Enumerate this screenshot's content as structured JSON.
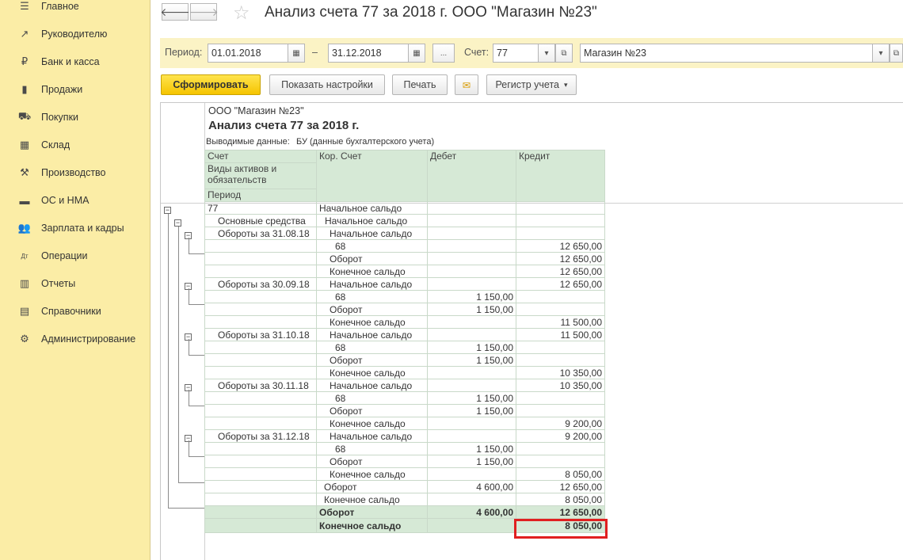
{
  "sidebar": {
    "items": [
      {
        "label": "Главное",
        "icon": "☰"
      },
      {
        "label": "Руководителю",
        "icon": "↗"
      },
      {
        "label": "Банк и касса",
        "icon": "₽"
      },
      {
        "label": "Продажи",
        "icon": "▮"
      },
      {
        "label": "Покупки",
        "icon": "⛟"
      },
      {
        "label": "Склад",
        "icon": "▦"
      },
      {
        "label": "Производство",
        "icon": "⚒"
      },
      {
        "label": "ОС и НМА",
        "icon": "▬"
      },
      {
        "label": "Зарплата и кадры",
        "icon": "👥"
      },
      {
        "label": "Операции",
        "icon": "Дт"
      },
      {
        "label": "Отчеты",
        "icon": "▥"
      },
      {
        "label": "Справочники",
        "icon": "▤"
      },
      {
        "label": "Администрирование",
        "icon": "⚙"
      }
    ]
  },
  "header": {
    "title": "Анализ счета 77 за 2018 г. ООО \"Магазин №23\""
  },
  "filters": {
    "period_label": "Период:",
    "date_from": "01.01.2018",
    "dash": "–",
    "date_to": "31.12.2018",
    "more": "...",
    "account_label": "Счет:",
    "account": "77",
    "org": "Магазин №23"
  },
  "toolbar": {
    "generate": "Сформировать",
    "settings": "Показать настройки",
    "print": "Печать",
    "register": "Регистр учета"
  },
  "report": {
    "org": "ООО \"Магазин №23\"",
    "title": "Анализ счета 77 за 2018 г.",
    "output_label": "Выводимые данные:",
    "output_value": "БУ (данные бухгалтерского учета)",
    "headers": {
      "account": "Счет",
      "assets": "Виды активов и обязательств",
      "period": "Период",
      "corr": "Кор. Счет",
      "debit": "Дебет",
      "credit": "Кредит"
    },
    "rows": [
      {
        "c1": "77",
        "c2": "Начальное сальдо",
        "d": "",
        "k": ""
      },
      {
        "c1": "Основные средства",
        "c2": "Начальное сальдо",
        "d": "",
        "k": ""
      },
      {
        "c1": "Обороты за 31.08.18",
        "c2": "Начальное сальдо",
        "d": "",
        "k": ""
      },
      {
        "c1": "",
        "c2": "68",
        "d": "",
        "k": "12 650,00"
      },
      {
        "c1": "",
        "c2": "Оборот",
        "d": "",
        "k": "12 650,00"
      },
      {
        "c1": "",
        "c2": "Конечное сальдо",
        "d": "",
        "k": "12 650,00"
      },
      {
        "c1": "Обороты за 30.09.18",
        "c2": "Начальное сальдо",
        "d": "",
        "k": "12 650,00"
      },
      {
        "c1": "",
        "c2": "68",
        "d": "1 150,00",
        "k": ""
      },
      {
        "c1": "",
        "c2": "Оборот",
        "d": "1 150,00",
        "k": ""
      },
      {
        "c1": "",
        "c2": "Конечное сальдо",
        "d": "",
        "k": "11 500,00"
      },
      {
        "c1": "Обороты за 31.10.18",
        "c2": "Начальное сальдо",
        "d": "",
        "k": "11 500,00"
      },
      {
        "c1": "",
        "c2": "68",
        "d": "1 150,00",
        "k": ""
      },
      {
        "c1": "",
        "c2": "Оборот",
        "d": "1 150,00",
        "k": ""
      },
      {
        "c1": "",
        "c2": "Конечное сальдо",
        "d": "",
        "k": "10 350,00"
      },
      {
        "c1": "Обороты за 30.11.18",
        "c2": "Начальное сальдо",
        "d": "",
        "k": "10 350,00"
      },
      {
        "c1": "",
        "c2": "68",
        "d": "1 150,00",
        "k": ""
      },
      {
        "c1": "",
        "c2": "Оборот",
        "d": "1 150,00",
        "k": ""
      },
      {
        "c1": "",
        "c2": "Конечное сальдо",
        "d": "",
        "k": "9 200,00"
      },
      {
        "c1": "Обороты за 31.12.18",
        "c2": "Начальное сальдо",
        "d": "",
        "k": "9 200,00"
      },
      {
        "c1": "",
        "c2": "68",
        "d": "1 150,00",
        "k": ""
      },
      {
        "c1": "",
        "c2": "Оборот",
        "d": "1 150,00",
        "k": ""
      },
      {
        "c1": "",
        "c2": "Конечное сальдо",
        "d": "",
        "k": "8 050,00"
      },
      {
        "c1": "",
        "c2": "Оборот",
        "d": "4 600,00",
        "k": "12 650,00"
      },
      {
        "c1": "",
        "c2": "Конечное сальдо",
        "d": "",
        "k": "8 050,00"
      }
    ],
    "totals": [
      {
        "c2": "Оборот",
        "d": "4 600,00",
        "k": "12 650,00"
      },
      {
        "c2": "Конечное сальдо",
        "d": "",
        "k": "8 050,00"
      }
    ]
  }
}
